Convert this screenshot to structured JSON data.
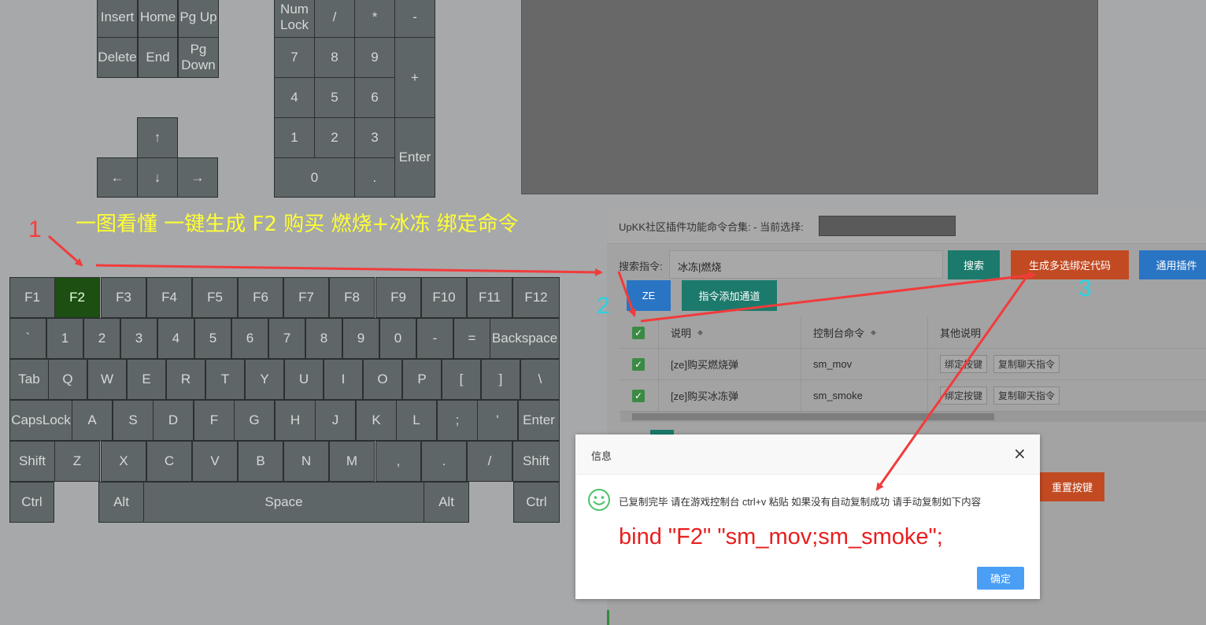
{
  "keyboard": {
    "nav_keys": [
      "Insert",
      "Home",
      "Pg Up",
      "Delete",
      "End",
      "Pg Down"
    ],
    "arrow_keys": [
      "↑",
      "←",
      "↓",
      "→"
    ],
    "numpad": [
      "Num Lock",
      "/",
      "*",
      "-",
      "7",
      "8",
      "9",
      "+",
      "4",
      "5",
      "6",
      "1",
      "2",
      "3",
      "Enter",
      "0",
      "."
    ],
    "function_row": [
      "F1",
      "F2",
      "F3",
      "F4",
      "F5",
      "F6",
      "F7",
      "F8",
      "F9",
      "F10",
      "F11",
      "F12"
    ],
    "number_row": [
      "`",
      "1",
      "2",
      "3",
      "4",
      "5",
      "6",
      "7",
      "8",
      "9",
      "0",
      "-",
      "=",
      "Backspace"
    ],
    "qwerty_row": [
      "Tab",
      "Q",
      "W",
      "E",
      "R",
      "T",
      "Y",
      "U",
      "I",
      "O",
      "P",
      "[",
      "]",
      "\\"
    ],
    "home_row": [
      "CapsLock",
      "A",
      "S",
      "D",
      "F",
      "G",
      "H",
      "J",
      "K",
      "L",
      ";",
      "'",
      "Enter"
    ],
    "shift_row": [
      "Shift",
      "Z",
      "X",
      "C",
      "V",
      "B",
      "N",
      "M",
      ",",
      ".",
      "/",
      "Shift"
    ],
    "bottom_row": [
      "Ctrl",
      "Alt",
      "Space",
      "Alt",
      "Ctrl"
    ],
    "selected_key": "F2",
    "active_color": "#1d4f12"
  },
  "annotation": {
    "headline": "一图看懂 一键生成 F2 购买 燃烧+冰冻 绑定命令",
    "step1": "1",
    "step2": "2",
    "step3": "3",
    "arrow_color": "#f23b3b",
    "step1_color": "#ff3b3b",
    "step23_color": "#29d3e0"
  },
  "panel": {
    "title": "UpKK社区插件功能命令合集: - 当前选择:",
    "search_label": "搜索指令:",
    "search_value": "冰冻|燃烧",
    "buttons": {
      "search": "搜索",
      "generate": "生成多选绑定代码",
      "common": "通用插件",
      "ze": "ZE",
      "add_channel": "指令添加通道",
      "reset": "重置按键"
    },
    "columns": [
      "说明",
      "控制台命令",
      "其他说明"
    ],
    "rows": [
      {
        "desc": "[ze]购买燃烧弹",
        "cmd": "sm_mov",
        "btn1": "绑定按键",
        "btn2": "复制聊天指令"
      },
      {
        "desc": "[ze]购买冰冻弹",
        "cmd": "sm_smoke",
        "btn1": "绑定按键",
        "btn2": "复制聊天指令"
      }
    ]
  },
  "dialog": {
    "title": "信息",
    "close": "×",
    "message": "已复制完毕 请在游戏控制台 ctrl+v 粘贴 如果没有自动复制成功 请手动复制如下内容",
    "code": "bind \"F2\" \"sm_mov;sm_smoke\";",
    "ok": "确定"
  }
}
